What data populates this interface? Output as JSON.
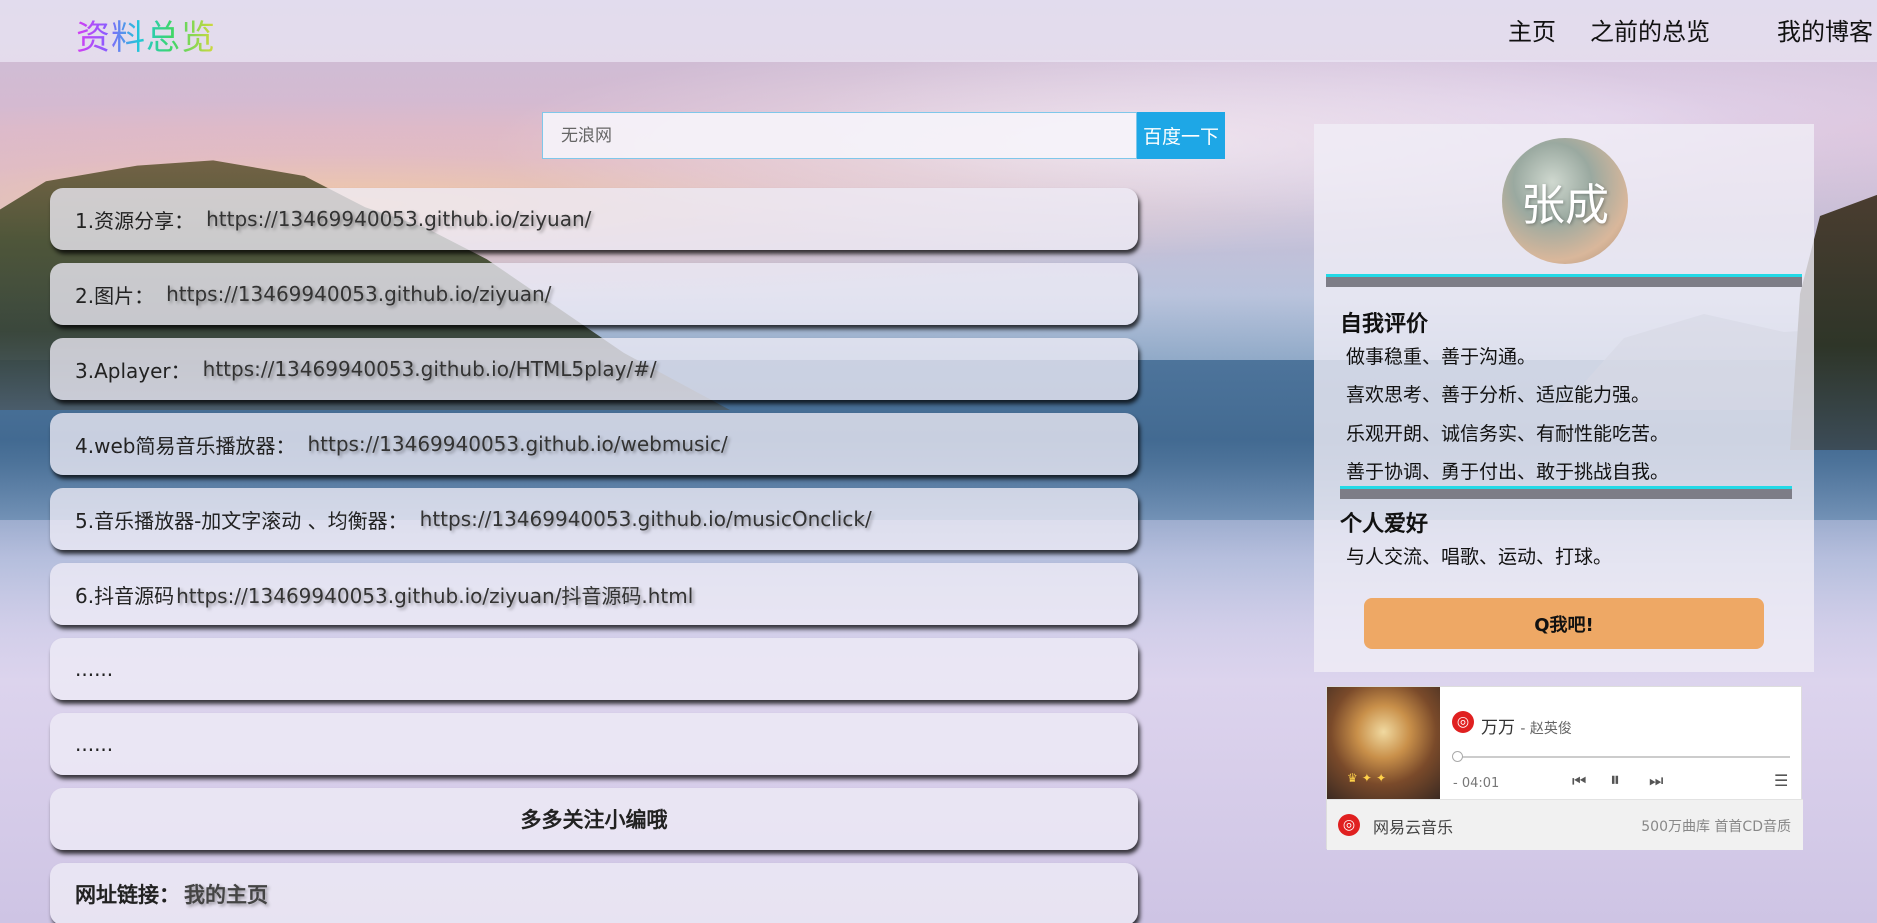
{
  "header": {
    "logo": "资料总览",
    "nav": [
      "主页",
      "之前的总览",
      "我的博客"
    ]
  },
  "search": {
    "placeholder": "无浪网",
    "button": "百度一下"
  },
  "list": [
    {
      "label": "1.资源分享：",
      "url": "https://13469940053.github.io/ziyuan/"
    },
    {
      "label": "2.图片：",
      "url": "https://13469940053.github.io/ziyuan/"
    },
    {
      "label": "3.Aplayer：",
      "url": "https://13469940053.github.io/HTML5play/#/"
    },
    {
      "label": "4.web简易音乐播放器：",
      "url": "https://13469940053.github.io/webmusic/"
    },
    {
      "label": "5.音乐播放器-加文字滚动 、均衡器：",
      "url": "https://13469940053.github.io/musicOnclick/"
    },
    {
      "label": "6.抖音源码",
      "url": "https://13469940053.github.io/ziyuan/抖音源码.html"
    },
    {
      "label": "......",
      "url": ""
    },
    {
      "label": "......",
      "url": ""
    }
  ],
  "follow_text": "多多关注小编哦",
  "link_row": {
    "label": "网址链接：",
    "link": "我的主页"
  },
  "profile": {
    "name": "张成",
    "self_eval_title": "自我评价",
    "self_eval": [
      "做事稳重、善于沟通。",
      "喜欢思考、善于分析、适应能力强。",
      "乐观开朗、诚信务实、有耐性能吃苦。",
      "善于协调、勇于付出、敢于挑战自我。"
    ],
    "hobby_title": "个人爱好",
    "hobby": "与人交流、唱歌、运动、打球。",
    "qq_button": "Q我吧!"
  },
  "player": {
    "song": "万万",
    "artist": "- 赵英俊",
    "time": "- 04:01",
    "brand": "网易云音乐",
    "promo": "500万曲库 首首CD音质",
    "progress": 0,
    "colors": {
      "accent": "#e02020"
    },
    "icons": [
      "netease-music-icon",
      "prev-icon",
      "pause-icon",
      "next-icon",
      "playlist-icon"
    ]
  },
  "colors": {
    "search_button": "#1ea7e6",
    "qq_button": "#eea865",
    "divider_accent": "#22d9e6"
  }
}
